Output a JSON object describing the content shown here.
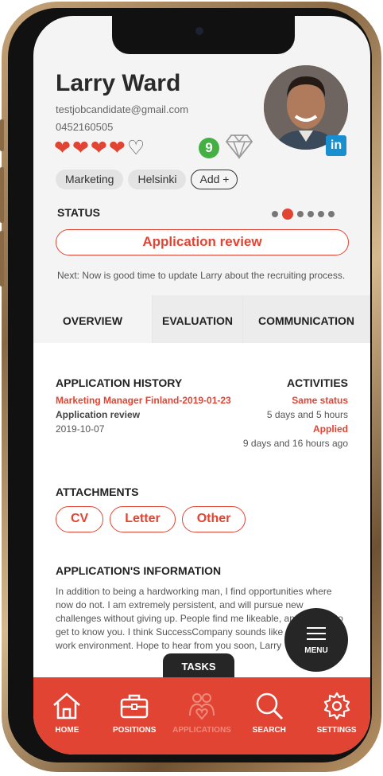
{
  "profile": {
    "name": "Larry Ward",
    "email": "testjobcandidate@gmail.com",
    "phone": "0452160505",
    "rating": 4,
    "rating_max": 5,
    "score": "9",
    "linkedin": "in"
  },
  "tags": [
    "Marketing",
    "Helsinki"
  ],
  "add_tag_label": "Add +",
  "status": {
    "label": "STATUS",
    "current": "Application review",
    "step_active": 2,
    "step_total": 6,
    "next_note": "Next: Now is good time to update Larry about the recruiting process."
  },
  "tabs": [
    "OVERVIEW",
    "EVALUATION",
    "COMMUNICATION"
  ],
  "history": {
    "title": "APPLICATION HISTORY",
    "position": "Marketing Manager Finland-2019-01-23",
    "stage": "Application review",
    "date": "2019-10-07"
  },
  "activities": {
    "title": "ACTIVITIES",
    "items": [
      {
        "label": "Same status",
        "time": "5 days and 5 hours"
      },
      {
        "label": "Applied",
        "time": "9 days and 16 hours ago"
      }
    ]
  },
  "attachments": {
    "title": "ATTACHMENTS",
    "items": [
      "CV",
      "Letter",
      "Other"
    ]
  },
  "info": {
    "title": "APPLICATION'S INFORMATION",
    "text": "In addition to being a hardworking man, I find opportunities where now do not. I am extremely persistent, and will pursue new challenges without giving up. People find me likeable, and I'd love to get to know you. I think SuccessCompany sounds like and amazing work environment. Hope to hear from you soon, Larry"
  },
  "menu_label": "MENU",
  "tasks_label": "TASKS",
  "nav": [
    "HOME",
    "POSITIONS",
    "APPLICATIONS",
    "SEARCH",
    "SETTINGS"
  ],
  "colors": {
    "accent": "#e14433",
    "dark": "#262626",
    "green": "#44b044"
  }
}
